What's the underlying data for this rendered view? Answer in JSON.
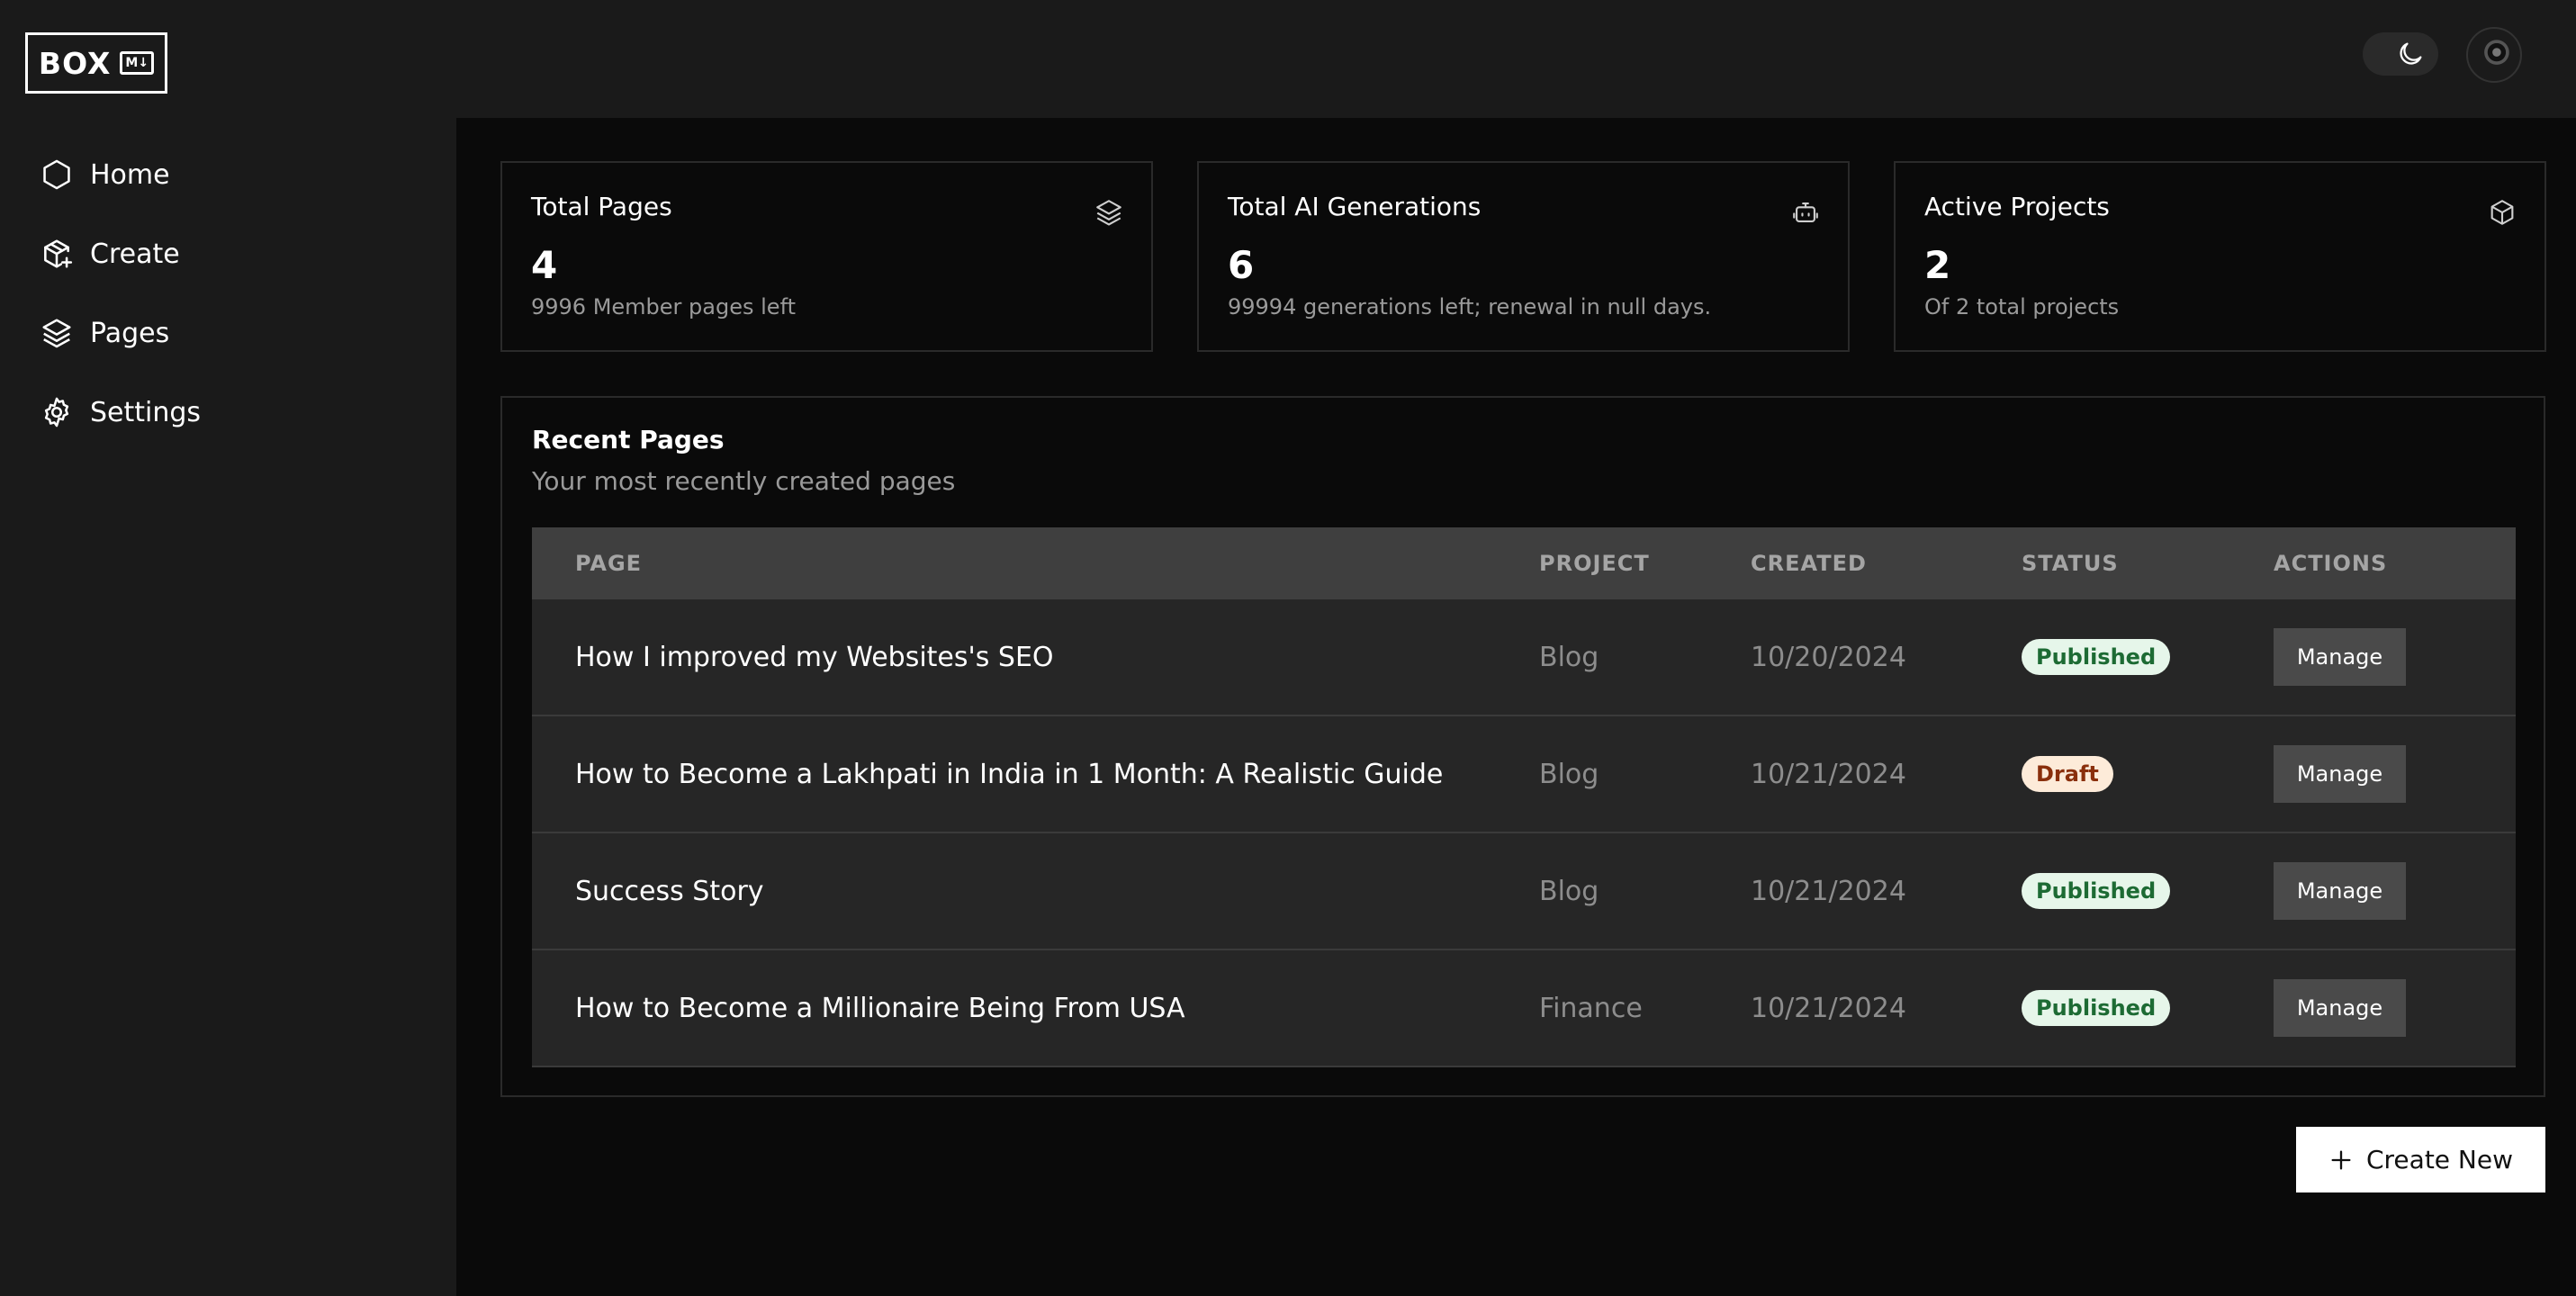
{
  "app": {
    "logo_text": "BOX",
    "logo_badge": "M↓"
  },
  "sidebar": {
    "items": [
      {
        "label": "Home",
        "icon": "hexagon-icon"
      },
      {
        "label": "Create",
        "icon": "package-plus-icon"
      },
      {
        "label": "Pages",
        "icon": "layers-icon"
      },
      {
        "label": "Settings",
        "icon": "gear-icon"
      }
    ]
  },
  "header": {
    "theme_icon": "moon-icon",
    "avatar": "user-avatar"
  },
  "stats": [
    {
      "title": "Total Pages",
      "value": "4",
      "sub": "9996 Member pages left",
      "icon": "layers-icon"
    },
    {
      "title": "Total AI Generations",
      "value": "6",
      "sub": "99994 generations left; renewal in null days.",
      "icon": "bot-icon"
    },
    {
      "title": "Active Projects",
      "value": "2",
      "sub": "Of 2 total projects",
      "icon": "box-icon"
    }
  ],
  "recent": {
    "title": "Recent Pages",
    "subtitle": "Your most recently created pages",
    "columns": [
      "PAGE",
      "PROJECT",
      "CREATED",
      "STATUS",
      "ACTIONS"
    ],
    "rows": [
      {
        "page": "How I improved my Websites's SEO",
        "project": "Blog",
        "created": "10/20/2024",
        "status": "Published",
        "action": "Manage"
      },
      {
        "page": "How to Become a Lakhpati in India in 1 Month: A Realistic Guide",
        "project": "Blog",
        "created": "10/21/2024",
        "status": "Draft",
        "action": "Manage"
      },
      {
        "page": "Success Story",
        "project": "Blog",
        "created": "10/21/2024",
        "status": "Published",
        "action": "Manage"
      },
      {
        "page": "How to Become a Millionaire Being From USA",
        "project": "Finance",
        "created": "10/21/2024",
        "status": "Published",
        "action": "Manage"
      }
    ]
  },
  "create_new_label": "Create New",
  "colors": {
    "published_bg": "#e6f6ea",
    "published_fg": "#1d6b34",
    "draft_bg": "#fdebd9",
    "draft_fg": "#8a2f0c"
  }
}
